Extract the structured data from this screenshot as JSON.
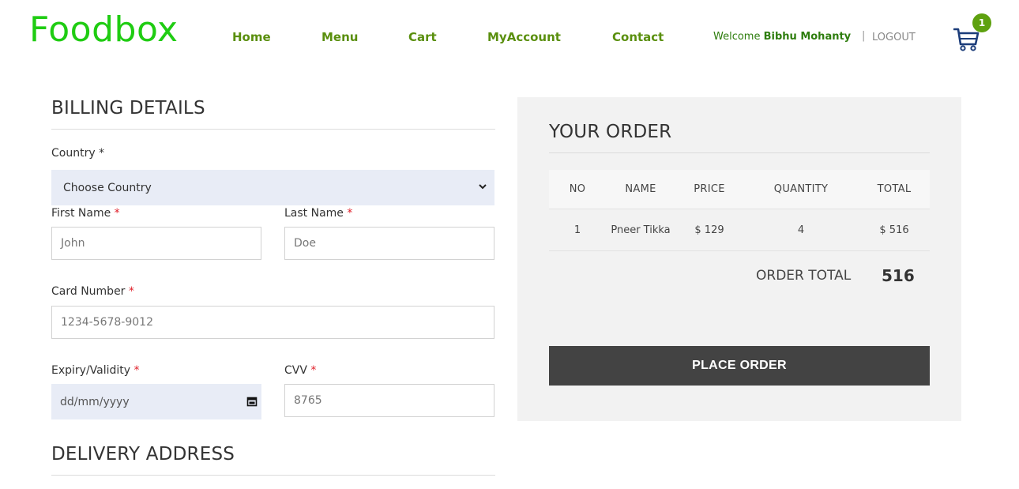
{
  "header": {
    "logo": "Foodbox",
    "nav": [
      {
        "label": "Home"
      },
      {
        "label": "Menu"
      },
      {
        "label": "Cart"
      },
      {
        "label": "MyAccount"
      },
      {
        "label": "Contact"
      }
    ],
    "welcome_prefix": "Welcome",
    "user_name": "Bibhu Mohanty",
    "separator": "|",
    "logout": "LOGOUT",
    "cart_count": "1",
    "cart_icon": "cart-icon"
  },
  "billing": {
    "title": "BILLING DETAILS",
    "country_label": "Country",
    "country_required": "*",
    "country_value": "Choose Country",
    "first_name_label": "First Name",
    "first_name_placeholder": "John",
    "last_name_label": "Last Name",
    "last_name_placeholder": "Doe",
    "card_label": "Card Number",
    "card_placeholder": "1234-5678-9012",
    "expiry_label": "Expiry/Validity",
    "expiry_placeholder": "dd/mm/yyyy",
    "cvv_label": "CVV",
    "cvv_placeholder": "8765",
    "required_mark": "*"
  },
  "delivery": {
    "title": "DELIVERY ADDRESS"
  },
  "order": {
    "title": "YOUR ORDER",
    "columns": [
      "NO",
      "NAME",
      "PRICE",
      "QUANTITY",
      "TOTAL"
    ],
    "rows": [
      {
        "no": "1",
        "name": "Pneer Tikka",
        "price": "$ 129",
        "quantity": "4",
        "total": "$ 516"
      }
    ],
    "total_label": "ORDER TOTAL",
    "total_value": "516",
    "place_order": "PLACE ORDER"
  },
  "colors": {
    "logo": "#1fcc12",
    "nav": "#5a8f0e",
    "badge": "#5ea10f",
    "button": "#434343",
    "required": "#e0202a"
  }
}
